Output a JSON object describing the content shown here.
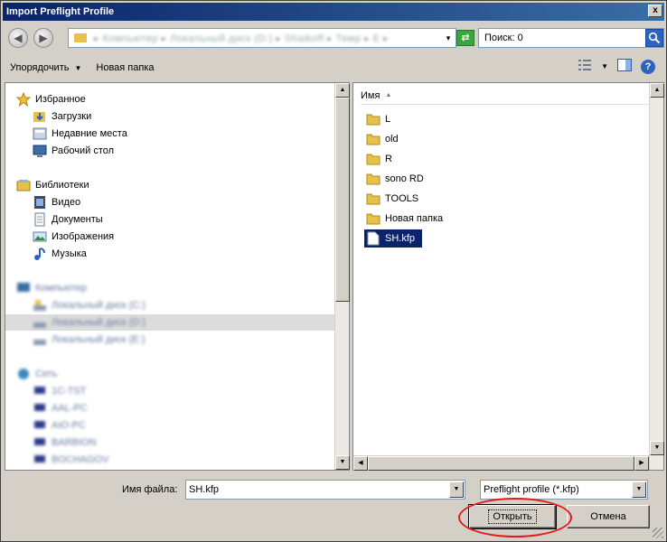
{
  "window": {
    "title": "Import Preflight Profile",
    "close": "x"
  },
  "address": {
    "path": "▸ Компьютер ▸ Локальный диск (D:) ▸ Shaikoff ▸ Темp ▸ E ▸",
    "drop": "▾"
  },
  "nav": {
    "back": "◀",
    "forward": "▶",
    "refresh": "⇄"
  },
  "search": {
    "value": "Поиск: 0"
  },
  "toolbar": {
    "organize": "Упорядочить",
    "organize_arrow": "▼",
    "new_folder": "Новая папка",
    "view_arrow": "▼",
    "help": "?"
  },
  "sidebar": {
    "favorites": "Избранное",
    "favorites_items": [
      "Загрузки",
      "Недавние места",
      "Рабочий стол"
    ],
    "libraries": "Библиотеки",
    "library_items": [
      "Видео",
      "Документы",
      "Изображения",
      "Музыка"
    ],
    "computer": "Компьютер",
    "computer_items": [
      "Локальный диск (C:)",
      "Локальный диск (D:)",
      "Локальный диск (E:)"
    ],
    "network": "Сеть",
    "network_items": [
      "1C-TST",
      "AAL-PC",
      "AIO-PC",
      "BARBION",
      "BOCHAGOV"
    ]
  },
  "files": {
    "column": "Имя",
    "sort_arrow": "▲",
    "items": [
      "L",
      "old",
      "R",
      "sono RD",
      "TOOLS",
      "Новая папка",
      "SH.kfp"
    ],
    "selected": "SH.kfp"
  },
  "bottom": {
    "filename_label": "Имя файла:",
    "filename_value": "SH.kfp",
    "filter": "Preflight profile (*.kfp)",
    "open": "Открыть",
    "cancel": "Отмена"
  },
  "colors": {
    "title_bar": "#0a246a",
    "selection": "#0a246a",
    "folder": "#e8c14a",
    "annotation": "#e41b1b"
  }
}
